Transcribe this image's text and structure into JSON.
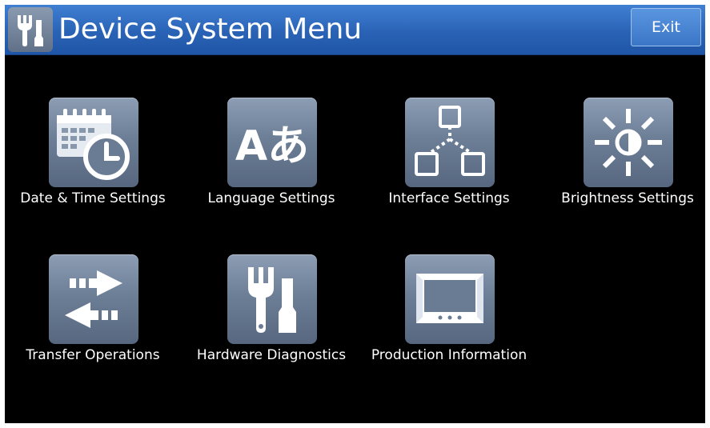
{
  "header": {
    "title": "Device System Menu",
    "exit_label": "Exit",
    "icon": "tools-icon"
  },
  "menu": {
    "items": [
      {
        "label": "Date & Time Settings",
        "icon": "calendar-clock-icon"
      },
      {
        "label": "Language Settings",
        "icon": "language-icon",
        "glyph": "Aあ"
      },
      {
        "label": "Interface Settings",
        "icon": "network-icon"
      },
      {
        "label": "Brightness Settings",
        "icon": "brightness-icon"
      },
      {
        "label": "Transfer Operations",
        "icon": "transfer-arrows-icon"
      },
      {
        "label": "Hardware Diagnostics",
        "icon": "tools-icon"
      },
      {
        "label": "Production Information",
        "icon": "device-panel-icon"
      }
    ]
  },
  "colors": {
    "header_blue": "#2a63b6",
    "background": "#000000",
    "icon_tile": "#6d7f97",
    "text": "#ffffff"
  }
}
